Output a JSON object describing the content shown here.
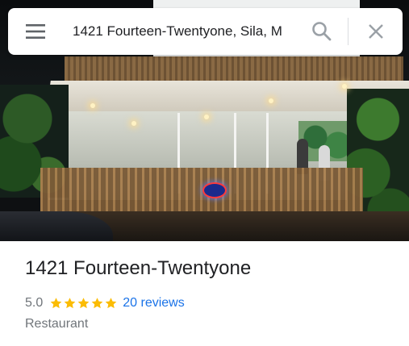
{
  "search": {
    "value": "1421 Fourteen-Twentyone, Sila, M"
  },
  "hero": {
    "sign_text": "OPEN"
  },
  "place": {
    "name": "1421 Fourteen-Twentyone",
    "rating": "5.0",
    "stars_count": 5,
    "reviews_label": "20 reviews",
    "category": "Restaurant"
  },
  "icons": {
    "menu": "hamburger-menu-icon",
    "search": "search-icon",
    "close": "close-icon",
    "star": "star-icon"
  },
  "colors": {
    "link": "#1a73e8",
    "star": "#fbbc04",
    "secondary_text": "#70757a",
    "icon": "#757575"
  }
}
